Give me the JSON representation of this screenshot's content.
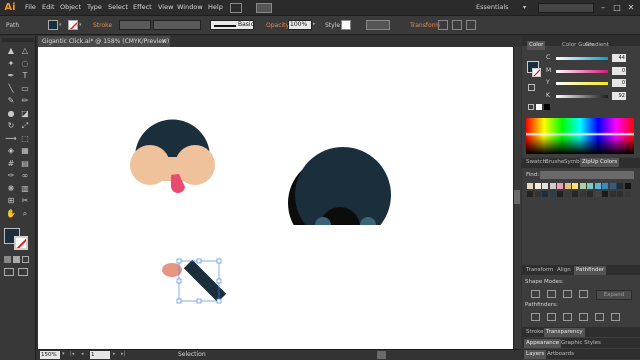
{
  "app": {
    "logo": "Ai",
    "menus": [
      "File",
      "Edit",
      "Object",
      "Type",
      "Select",
      "Effect",
      "View",
      "Window",
      "Help"
    ],
    "workspace": "Essentials",
    "window_controls": [
      "–",
      "□",
      "✕"
    ]
  },
  "control_bar": {
    "selection_type": "Path",
    "stroke_label": "Stroke",
    "brush_label": "Basic",
    "opacity_label": "Opacity:",
    "opacity_value": "100%",
    "style_label": "Style:",
    "transform_label": "Transform"
  },
  "document": {
    "tab_title": "Gigantic Click.ai* @ 158% (CMYK/Preview)",
    "close_glyph": "×"
  },
  "status_bar": {
    "zoom": "150%",
    "page": "1",
    "tool": "Selection"
  },
  "panels": {
    "color_tabs": [
      "Color",
      "Color Guide",
      "Gradient"
    ],
    "sliders": [
      {
        "label": "C",
        "value": "44",
        "color": "#00a0d2"
      },
      {
        "label": "M",
        "value": "0",
        "color": "#d8157b"
      },
      {
        "label": "Y",
        "value": "0",
        "color": "#f7e61a"
      },
      {
        "label": "K",
        "value": "92",
        "color": "#1a1a1a"
      }
    ],
    "swatch_tabs": [
      "Swatch",
      "Brushe",
      "Symbo",
      "ZipUp Colors"
    ],
    "find_label": "Find:",
    "pathfinder_tabs": [
      "Transform",
      "Align",
      "Pathfinder"
    ],
    "shape_modes_label": "Shape Modes:",
    "expand_label": "Expand",
    "pathfinders_label": "Pathfinders:",
    "stroke_tabs": [
      "Stroke",
      "Transparency"
    ],
    "appearance_tabs": [
      "Appearance",
      "Graphic Styles"
    ],
    "layers_tabs": [
      "Layers",
      "Artboards"
    ]
  },
  "colors": {
    "navy": "#1a2e3b",
    "skin": "#f0c29b",
    "tongue": "#e84c6f",
    "black": "#0c0c0c",
    "teal": "#3c6478",
    "salmon": "#e89582",
    "accent": "#f0884a"
  },
  "icons": {
    "tools": [
      "selection-arrow",
      "direct-select",
      "magic-wand",
      "lasso",
      "pen",
      "type",
      "line",
      "rectangle",
      "paintbrush",
      "pencil",
      "blob-brush",
      "eraser",
      "rotate",
      "scale",
      "width",
      "free-transform",
      "shape-builder",
      "perspective",
      "mesh",
      "gradient",
      "eyedropper",
      "blend",
      "symbol-sprayer",
      "column-graph",
      "artboard",
      "slice",
      "hand",
      "zoom"
    ]
  }
}
